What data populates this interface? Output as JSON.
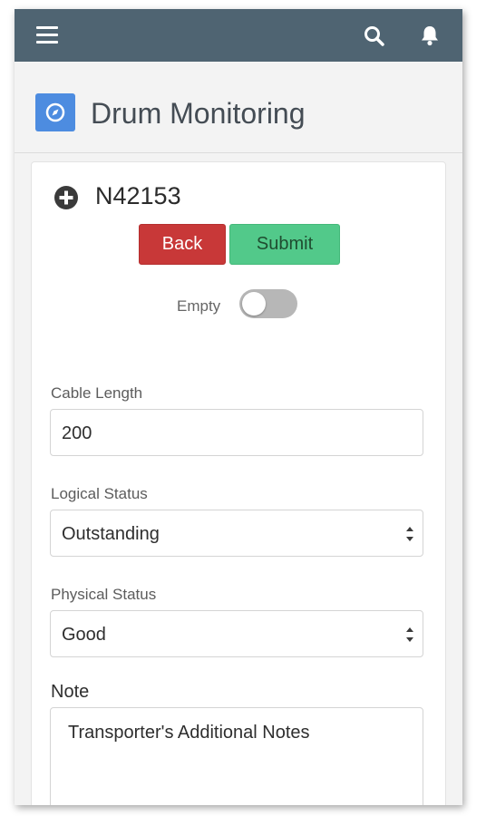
{
  "header": {
    "title": "Drum Monitoring"
  },
  "record": {
    "id": "N42153"
  },
  "actions": {
    "back_label": "Back",
    "submit_label": "Submit"
  },
  "toggle": {
    "label": "Empty",
    "checked": false
  },
  "fields": {
    "cable_length": {
      "label": "Cable Length",
      "value": "200"
    },
    "logical_status": {
      "label": "Logical Status",
      "value": "Outstanding"
    },
    "physical_status": {
      "label": "Physical Status",
      "value": "Good"
    },
    "note": {
      "label": "Note",
      "placeholder": "Transporter's Additional Notes"
    }
  },
  "icons": {
    "menu": "hamburger-menu-icon",
    "search": "search-icon",
    "notifications": "bell-icon",
    "app": "compass-icon",
    "record": "plus-circle-icon"
  },
  "colors": {
    "topbar": "#4f6472",
    "app_icon": "#4d8ce0",
    "back_button": "#c83838",
    "submit_button": "#52c98a",
    "toggle_off": "#b7b7b7"
  }
}
